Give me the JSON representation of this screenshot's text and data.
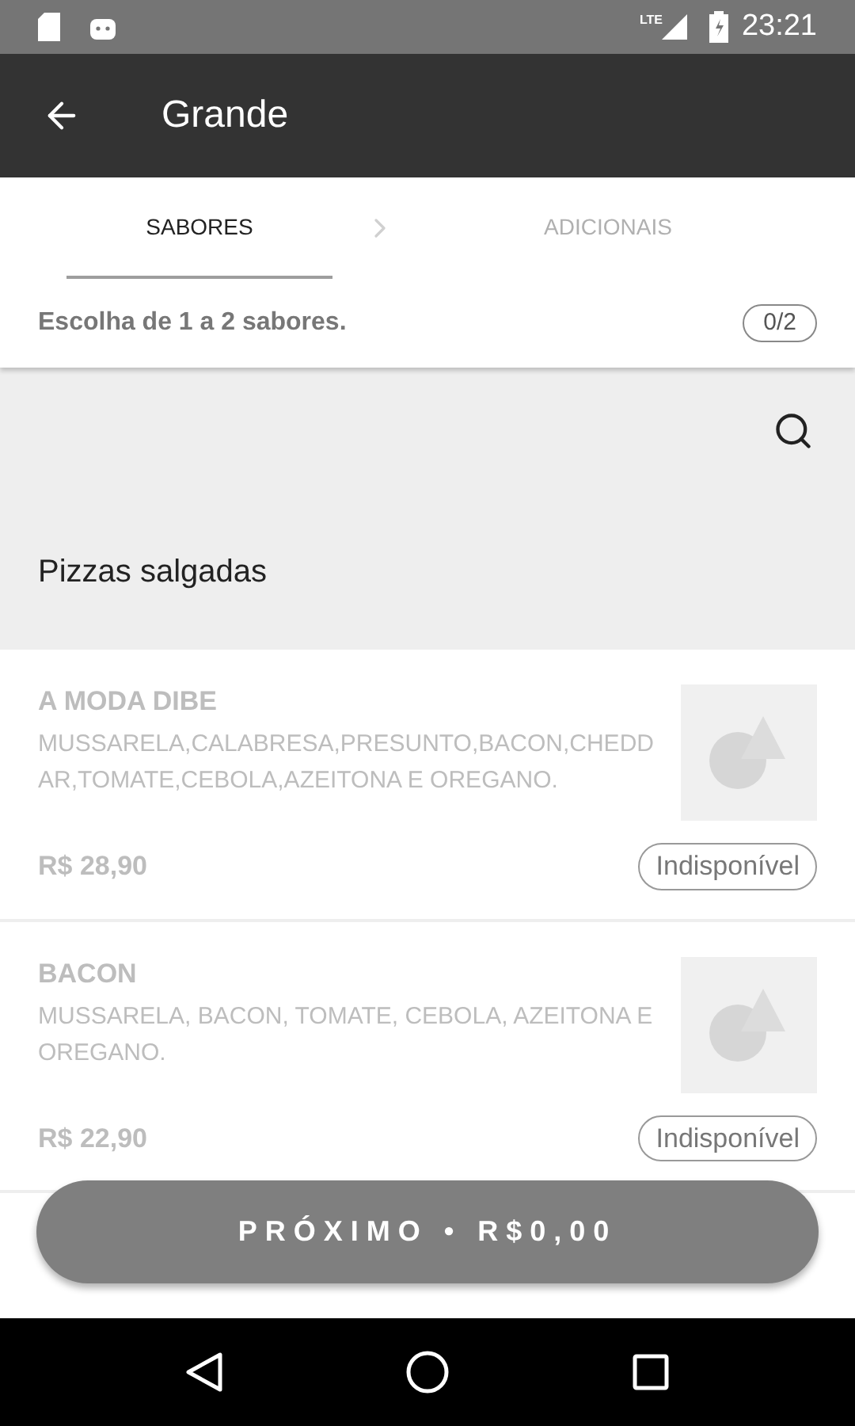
{
  "status_bar": {
    "network": "LTE",
    "time": "23:21"
  },
  "app_bar": {
    "title": "Grande"
  },
  "tabs": [
    {
      "label": "SABORES",
      "selected": true
    },
    {
      "label": "ADICIONAIS",
      "selected": false
    }
  ],
  "hint": {
    "text": "Escolha de 1 a 2 sabores.",
    "count": "0/2"
  },
  "section": {
    "title": "Pizzas salgadas"
  },
  "items": [
    {
      "name": "A MODA DIBE",
      "description": "MUSSARELA,CALABRESA,PRESUNTO,BACON,CHEDDAR,TOMATE,CEBOLA,AZEITONA E OREGANO.",
      "price": "R$ 28,90",
      "badge": "Indisponível",
      "available": false
    },
    {
      "name": "BACON",
      "description": "MUSSARELA, BACON, TOMATE, CEBOLA, AZEITONA E OREGANO.",
      "price": "R$ 22,90",
      "badge": "Indisponível",
      "available": false
    }
  ],
  "next_button": {
    "label": "PRÓXIMO • R$0,00"
  }
}
